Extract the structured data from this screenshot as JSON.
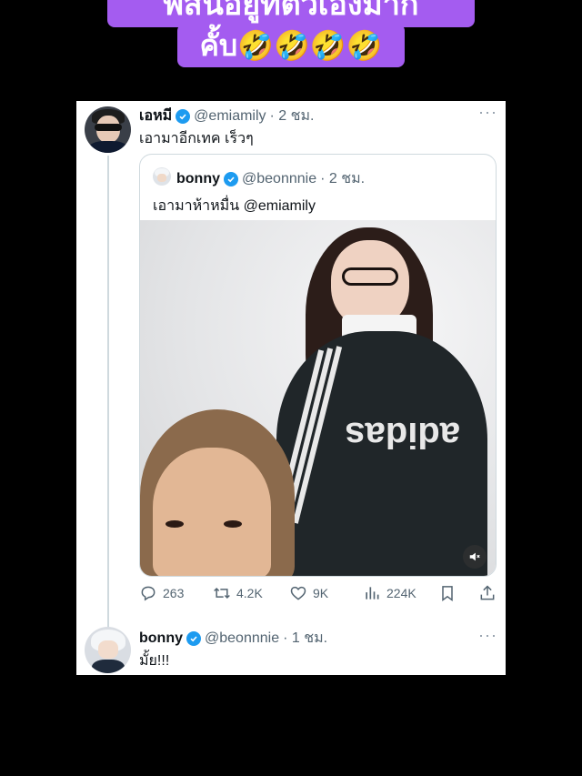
{
  "caption": {
    "line1": "พี่สิ้นอยู่ที่ตัวเองมาก",
    "line2": "คั้บ🤣🤣🤣🤣"
  },
  "tweet": {
    "author_name": "เอหมี",
    "author_handle": "@emiamily",
    "time": "· 2 ชม.",
    "more": "···",
    "text": "เอามาอีกเทค เร็วๆ",
    "quote": {
      "author_name": "bonny",
      "author_handle": "@beonnnie",
      "time": "· 2 ชม.",
      "text": "เอามาห้าหมื่น @emiamily"
    },
    "stats": {
      "replies": "263",
      "retweets": "4.2K",
      "likes": "9K",
      "views": "224K"
    }
  },
  "reply": {
    "author_name": "bonny",
    "author_handle": "@beonnnie",
    "time": "· 1 ชม.",
    "more": "···",
    "text": "มั้ย!!!"
  },
  "colors": {
    "caption_bg": "#a45cf0",
    "verified": "#1d9bf0",
    "secondary_text": "#536471"
  }
}
